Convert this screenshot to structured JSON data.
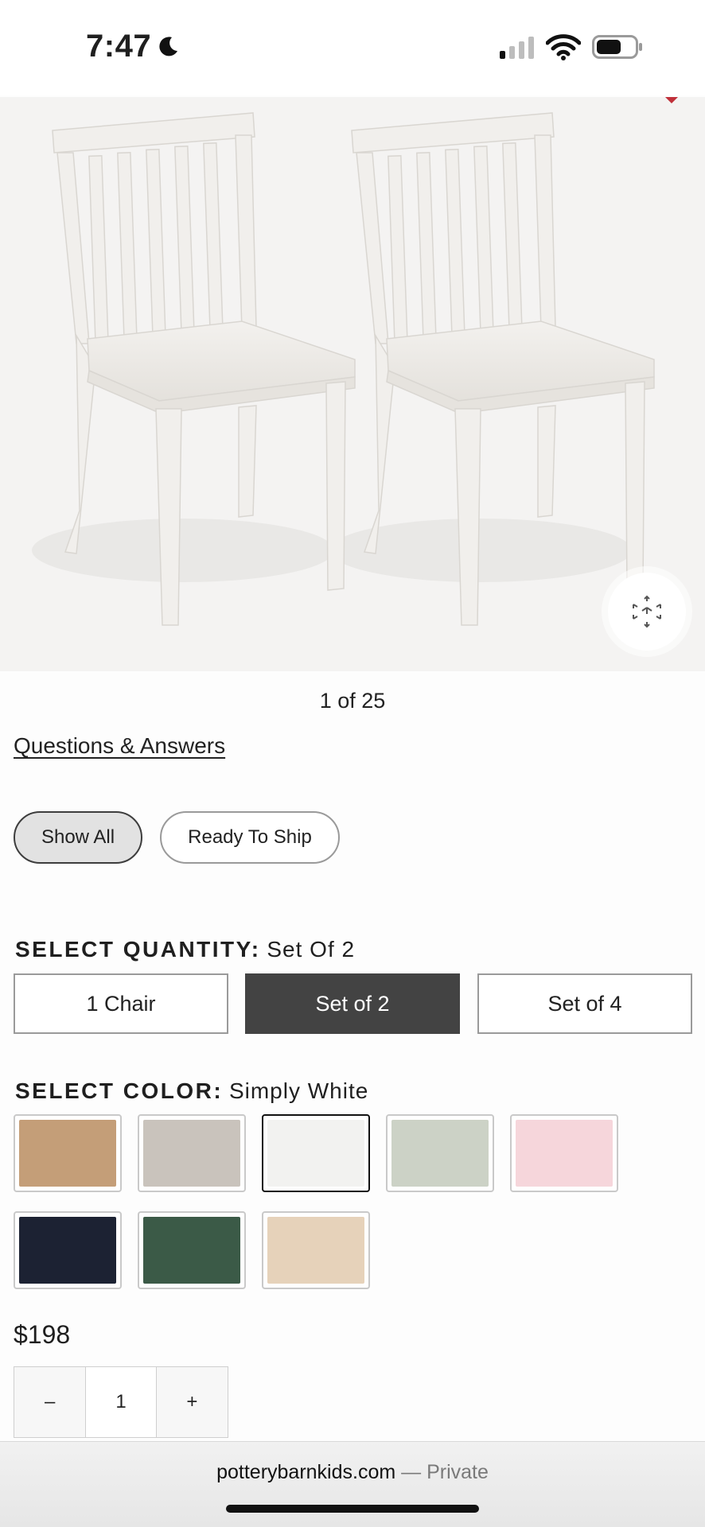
{
  "status_bar": {
    "time": "7:47",
    "signal_bars_active": 1,
    "signal_bars_total": 4,
    "battery_level": 0.6
  },
  "product": {
    "image_counter": "1 of 25",
    "qa_link": "Questions & Answers",
    "filters": [
      {
        "label": "Show All",
        "selected": true
      },
      {
        "label": "Ready To Ship",
        "selected": false
      }
    ],
    "quantity": {
      "label": "SELECT QUANTITY:",
      "value": "Set Of 2",
      "options": [
        {
          "label": "1 Chair",
          "selected": false
        },
        {
          "label": "Set of 2",
          "selected": true
        },
        {
          "label": "Set of 4",
          "selected": false
        }
      ]
    },
    "color": {
      "label": "SELECT COLOR:",
      "value": "Simply White",
      "swatches": [
        {
          "color": "#c49e78",
          "selected": false
        },
        {
          "color": "#c9c3bc",
          "selected": false
        },
        {
          "color": "#f2f2f0",
          "selected": true
        },
        {
          "color": "#ccd2c6",
          "selected": false
        },
        {
          "color": "#f6d6db",
          "selected": false
        },
        {
          "color": "#1c2233",
          "selected": false
        },
        {
          "color": "#3b5a47",
          "selected": false
        },
        {
          "color": "#e6d2ba",
          "selected": false
        }
      ]
    },
    "price": "$198",
    "stepper": {
      "minus": "–",
      "value": "1",
      "plus": "+"
    }
  },
  "browser": {
    "domain": "potterybarnkids.com",
    "mode": " — Private"
  },
  "colors": {
    "accent_dark": "#434343",
    "chair_white": "#f1efec"
  }
}
